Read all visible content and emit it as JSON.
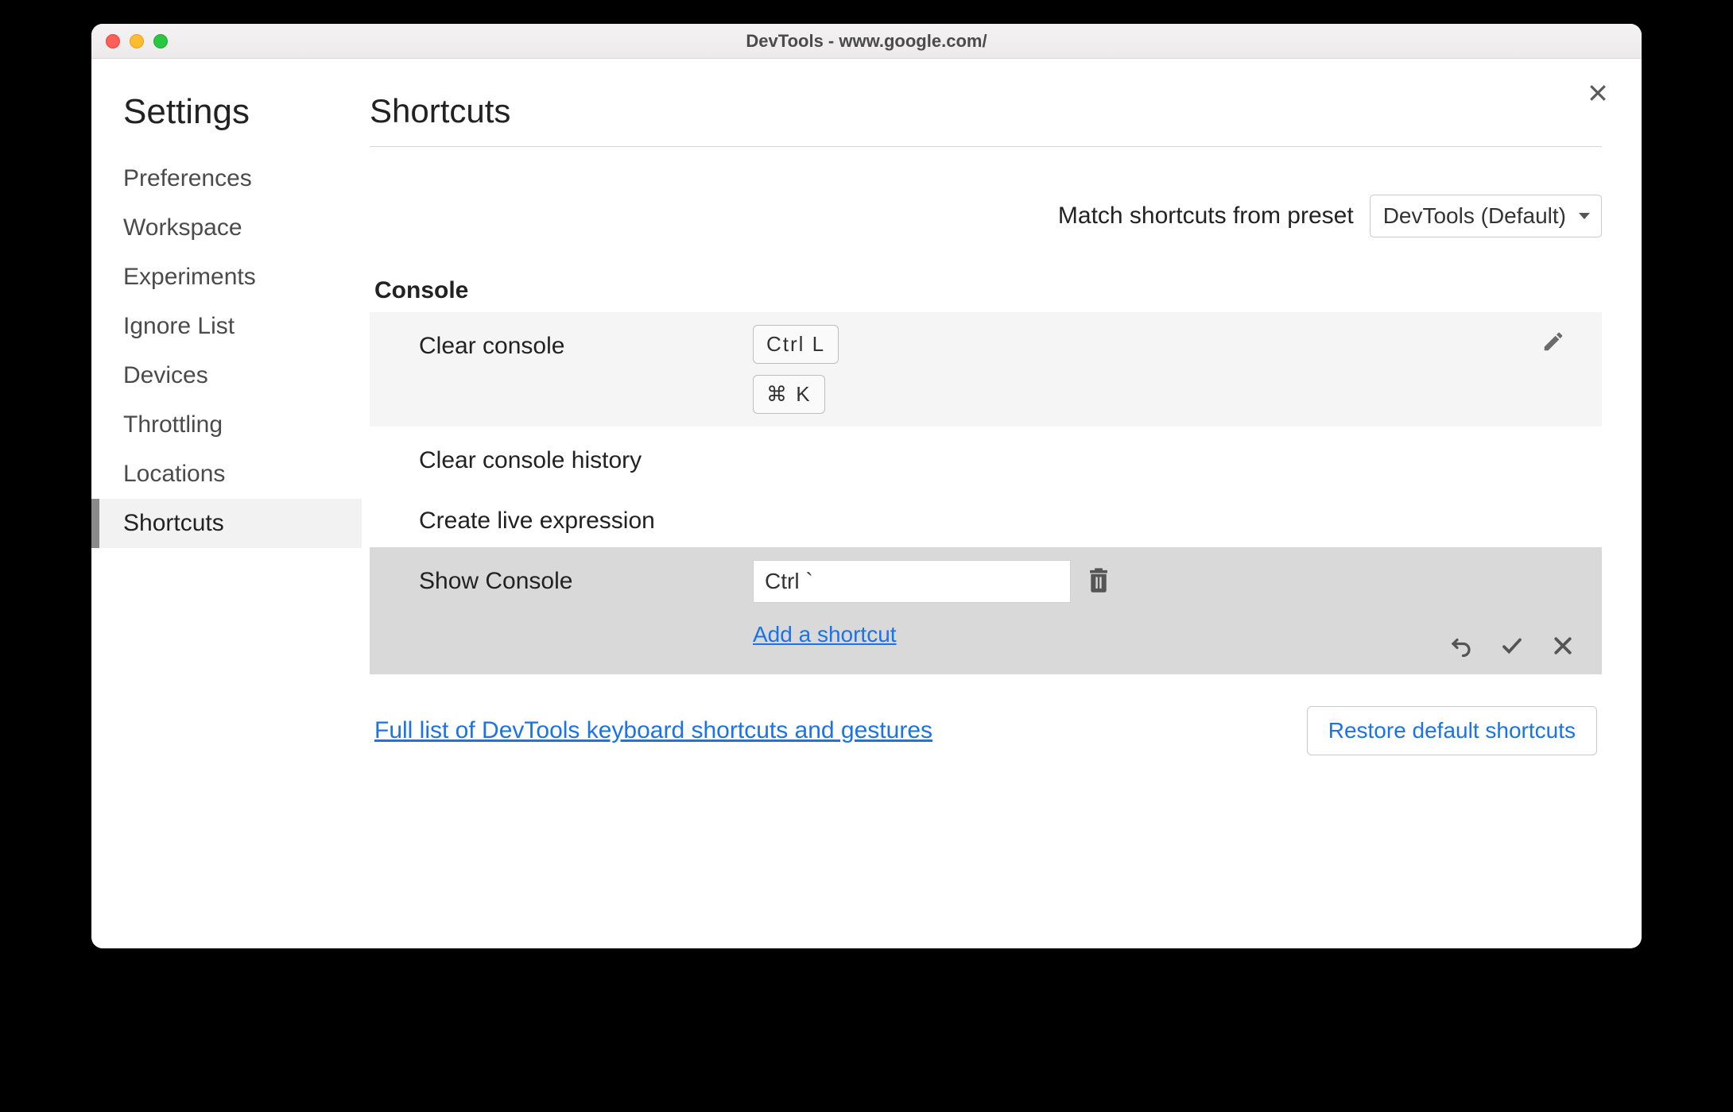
{
  "window": {
    "title": "DevTools - www.google.com/"
  },
  "sidebar": {
    "heading": "Settings",
    "items": [
      {
        "label": "Preferences"
      },
      {
        "label": "Workspace"
      },
      {
        "label": "Experiments"
      },
      {
        "label": "Ignore List"
      },
      {
        "label": "Devices"
      },
      {
        "label": "Throttling"
      },
      {
        "label": "Locations"
      },
      {
        "label": "Shortcuts",
        "active": true
      }
    ]
  },
  "main": {
    "heading": "Shortcuts",
    "preset_label": "Match shortcuts from preset",
    "preset_value": "DevTools (Default)",
    "section": "Console",
    "rows": {
      "clear_console": {
        "label": "Clear console",
        "keys": [
          "Ctrl L",
          "⌘ K"
        ]
      },
      "clear_history": {
        "label": "Clear console history"
      },
      "create_live": {
        "label": "Create live expression"
      },
      "show_console": {
        "label": "Show Console",
        "input_value": "Ctrl `",
        "add_label": "Add a shortcut"
      }
    },
    "footer_link": "Full list of DevTools keyboard shortcuts and gestures",
    "restore_label": "Restore default shortcuts"
  }
}
